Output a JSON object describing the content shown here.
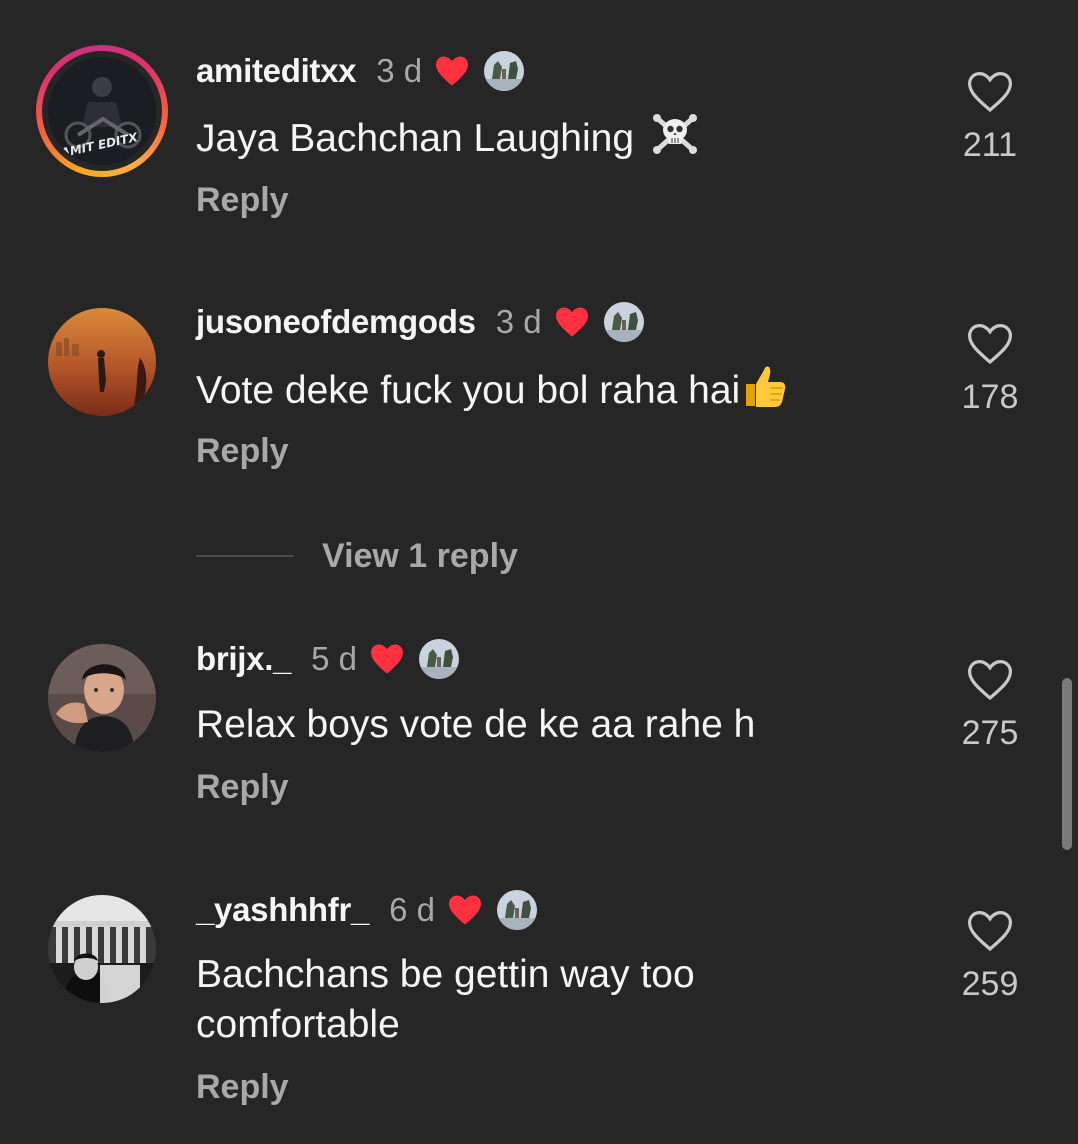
{
  "comments": [
    {
      "username": "amiteditxx",
      "time": "3 d",
      "text": "Jaya Bachchan Laughing",
      "emoji": "skull-and-crossbones",
      "reply_label": "Reply",
      "likes": "211",
      "has_story_ring": true,
      "avatar_text": "AMIT EDITX",
      "creator_liked": true
    },
    {
      "username": "jusoneofdemgods",
      "time": "3 d",
      "text": "Vote deke fuck you bol raha hai",
      "emoji": "thumbs-up",
      "reply_label": "Reply",
      "likes": "178",
      "has_story_ring": false,
      "creator_liked": true
    },
    {
      "username": "brijx._",
      "time": "5 d",
      "text": "Relax boys vote de ke aa rahe h",
      "reply_label": "Reply",
      "likes": "275",
      "has_story_ring": false,
      "creator_liked": true
    },
    {
      "username": "_yashhhfr_",
      "time": "6 d",
      "text_line1": "Bachchans be gettin way too",
      "text_line2": "comfortable",
      "reply_label": "Reply",
      "likes": "259",
      "has_story_ring": false,
      "creator_liked": true
    }
  ],
  "view_replies_label": "View 1 reply",
  "colors": {
    "background": "#262626",
    "primary_text": "#f5f5f5",
    "secondary_text": "#a8a8a8",
    "heart_red": "#ff3040"
  },
  "icons": {
    "like": "heart-outline-icon",
    "creator_liked": "heart-filled-icon"
  }
}
